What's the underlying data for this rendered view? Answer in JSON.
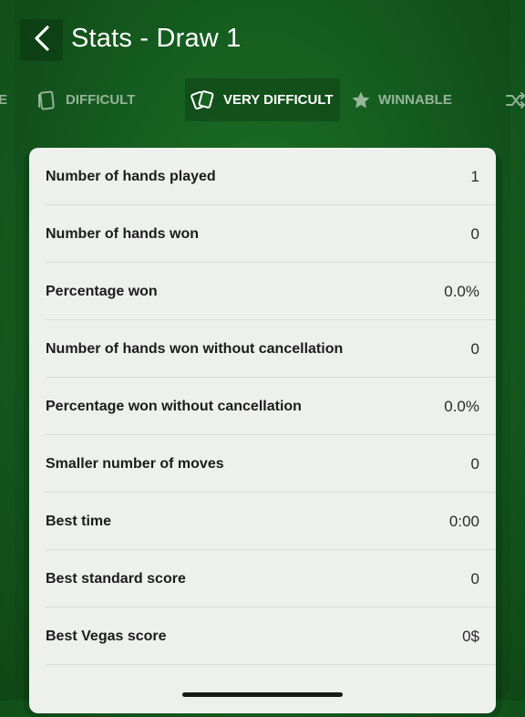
{
  "header": {
    "title": "Stats - Draw 1"
  },
  "tabs": [
    {
      "label": "E",
      "icon": "partial-tab"
    },
    {
      "label": "DIFFICULT",
      "icon": "card-icon"
    },
    {
      "label": "VERY DIFFICULT",
      "icon": "cards-icon",
      "active": true
    },
    {
      "label": "WINNABLE",
      "icon": "star-icon"
    },
    {
      "label": "",
      "icon": "shuffle-icon"
    }
  ],
  "stats": [
    {
      "label": "Number of hands played",
      "value": "1"
    },
    {
      "label": "Number of hands won",
      "value": "0"
    },
    {
      "label": "Percentage won",
      "value": "0.0%"
    },
    {
      "label": "Number of hands won without cancellation",
      "value": "0"
    },
    {
      "label": "Percentage won without cancellation",
      "value": "0.0%"
    },
    {
      "label": "Smaller number of moves",
      "value": "0"
    },
    {
      "label": "Best time",
      "value": "0:00"
    },
    {
      "label": "Best standard score",
      "value": "0"
    },
    {
      "label": "Best Vegas score",
      "value": "0$"
    }
  ],
  "colors": {
    "background": "#176322",
    "card": "#eef0ee",
    "text": "#1c1c1c"
  }
}
